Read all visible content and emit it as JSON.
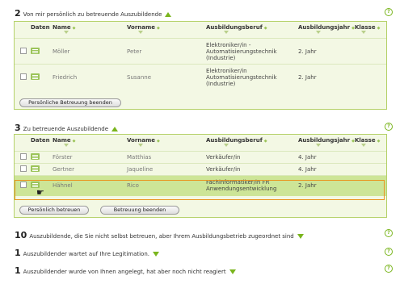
{
  "section1": {
    "num": "2",
    "text": "Von mir persönlich zu betreuende Auszubildende",
    "button": "Persönliche Betreuung beenden"
  },
  "headers": {
    "daten": "Daten",
    "name": "Name",
    "vorname": "Vorname",
    "beruf": "Ausbildungsberuf",
    "jahr": "Ausbildungsjahr",
    "klasse": "Klasse"
  },
  "table1": [
    {
      "name": "Möller",
      "vorname": "Peter",
      "beruf": "Elektroniker/in - Automatisierungstechnik (Industrie)",
      "jahr": "2. Jahr"
    },
    {
      "name": "Friedrich",
      "vorname": "Susanne",
      "beruf": "Elektroniker/in Automatisierungstechnik (Industrie)",
      "jahr": "2. Jahr"
    }
  ],
  "section2": {
    "num": "3",
    "text": "Zu betreuende Auszubildende",
    "button1": "Persönlich betreuen",
    "button2": "Betreuung beenden"
  },
  "table2": [
    {
      "name": "Förster",
      "vorname": "Matthias",
      "beruf": "Verkäufer/in",
      "jahr": "4. Jahr"
    },
    {
      "name": "Gertner",
      "vorname": "Jaqueline",
      "beruf": "Verkäufer/in",
      "jahr": "4. Jahr"
    },
    {
      "name": "Hähnel",
      "vorname": "Rico",
      "beruf": "Fachinformatiker/in FR Anwendungsentwicklung",
      "jahr": "2. Jahr"
    }
  ],
  "section3": {
    "num": "10",
    "text": "Auszubildende, die Sie nicht selbst betreuen, aber Ihrem Ausbildungsbetrieb zugeordnet sind"
  },
  "section4": {
    "num": "1",
    "text": "Auszubildender wartet auf Ihre Legitimation."
  },
  "section5": {
    "num": "1",
    "text": "Auszubildender wurde von Ihnen angelegt, hat aber noch nicht reagiert"
  },
  "help": "?",
  "colors": {
    "accent": "#7ab51d",
    "panel": "#f3f8e4",
    "highlight": "#cde597",
    "selected_border": "#e8941e"
  }
}
